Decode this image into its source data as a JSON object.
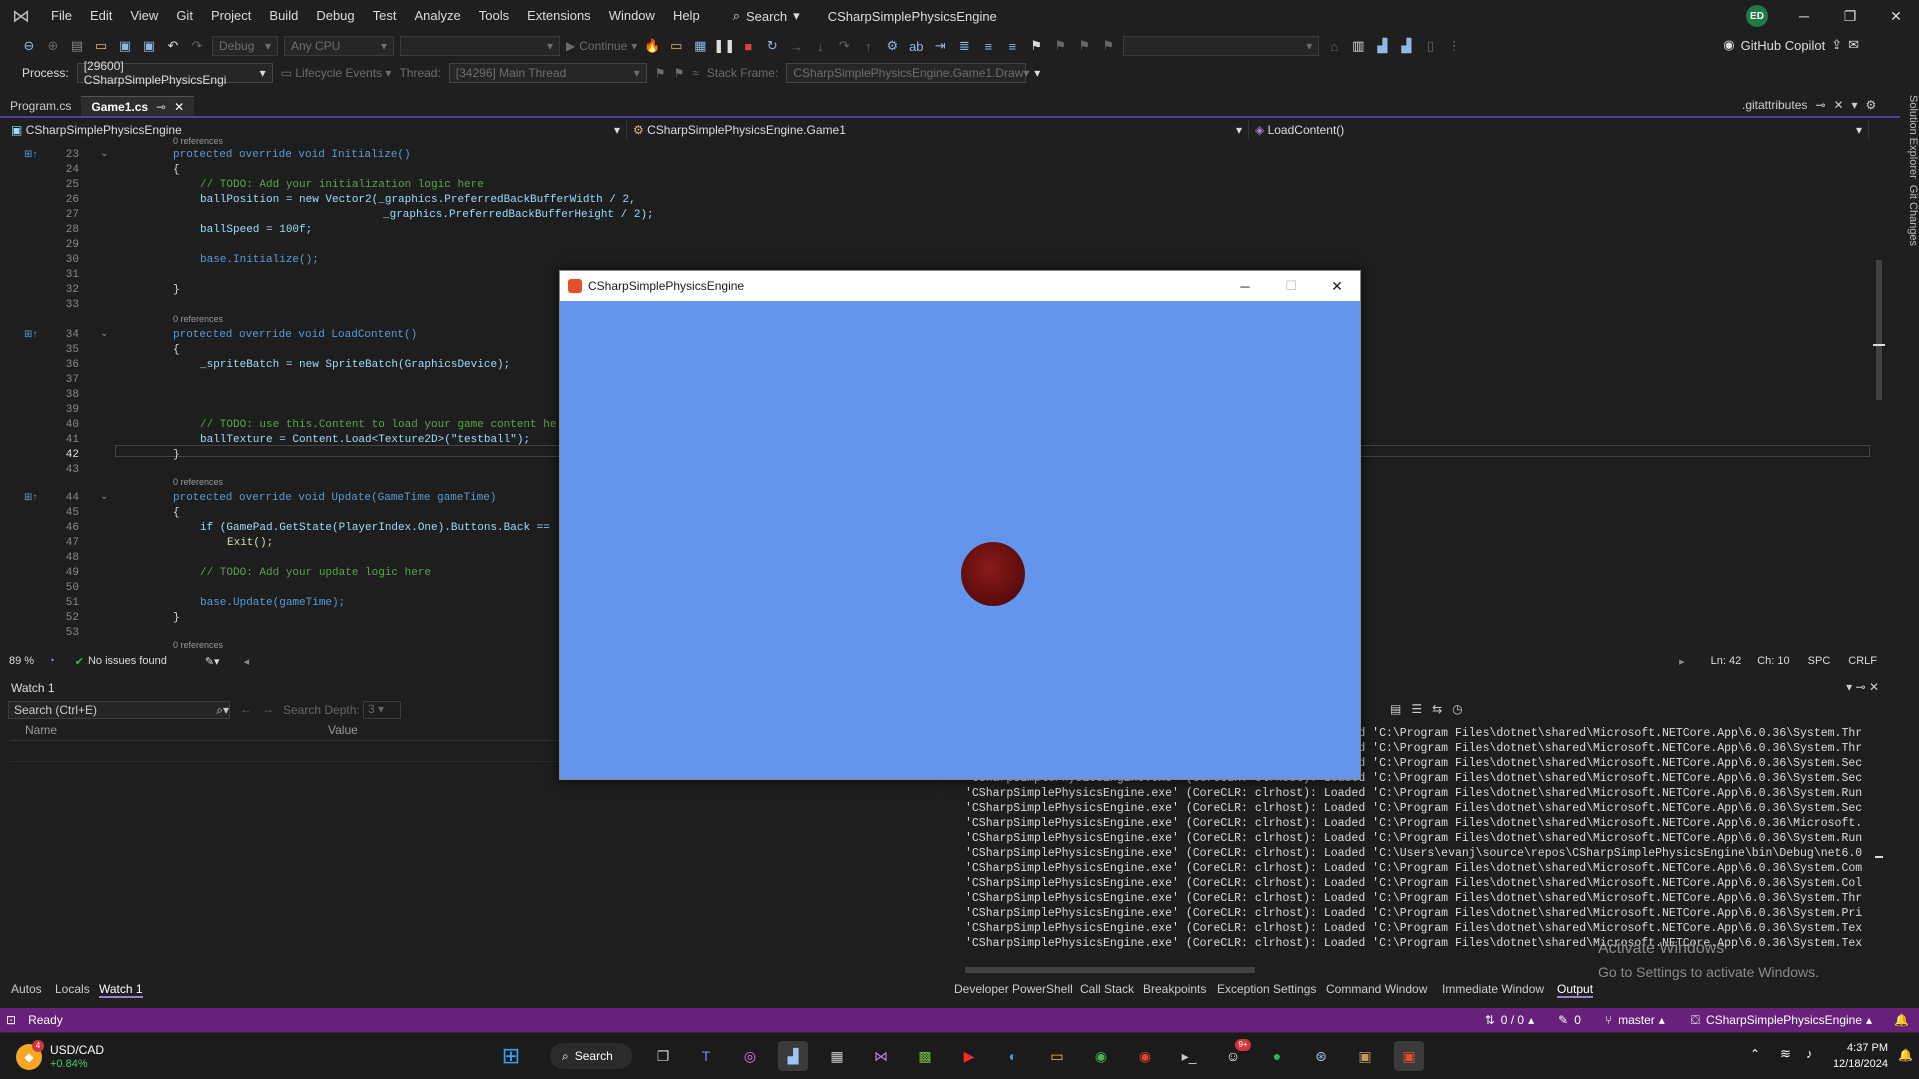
{
  "titlebar": {
    "menu": [
      "File",
      "Edit",
      "View",
      "Git",
      "Project",
      "Build",
      "Debug",
      "Test",
      "Analyze",
      "Tools",
      "Extensions",
      "Window",
      "Help"
    ],
    "search_label": "Search",
    "solution": "CSharpSimplePhysicsEngine",
    "avatar": "ED"
  },
  "toolbar": {
    "config": "Debug",
    "platform": "Any CPU",
    "continue": "Continue",
    "copilot": "GitHub Copilot"
  },
  "procbar": {
    "process_label": "Process:",
    "process_value": "[29600] CSharpSimplePhysicsEngi",
    "lifecycle": "Lifecycle Events",
    "thread_label": "Thread:",
    "thread_value": "[34296] Main Thread",
    "stackframe_label": "Stack Frame:",
    "stackframe_value": "CSharpSimplePhysicsEngine.Game1.Draw"
  },
  "tabs": [
    {
      "label": "Program.cs"
    },
    {
      "label": "Game1.cs"
    }
  ],
  "gitattributes": ".gitattributes",
  "navbar": {
    "project": "CSharpSimplePhysicsEngine",
    "class": "CSharpSimplePhysicsEngine.Game1",
    "member": "LoadContent()"
  },
  "editor": {
    "refs": "0 references",
    "lines": {
      "l23": "protected override void Initialize()",
      "l25": "// TODO: Add your initialization logic here",
      "l26": "ballPosition = new Vector2(_graphics.PreferredBackBufferWidth / 2,",
      "l27": "_graphics.PreferredBackBufferHeight / 2);",
      "l28": "ballSpeed = 100f;",
      "l30": "base.Initialize();",
      "l34": "protected override void LoadContent()",
      "l36": "_spriteBatch = new SpriteBatch(GraphicsDevice);",
      "l40": "// TODO: use this.Content to load your game content he",
      "l41": "ballTexture = Content.Load<Texture2D>(\"testball\");",
      "l44": "protected override void Update(GameTime gameTime)",
      "l46": "if (GamePad.GetState(PlayerIndex.One).Buttons.Back ==",
      "l47": "Exit();",
      "l49": "// TODO: Add your update logic here",
      "l51": "base.Update(gameTime);"
    }
  },
  "edstatus": {
    "zoom": "89 %",
    "issues": "No issues found",
    "ln": "Ln: 42",
    "ch": "Ch: 10",
    "spc": "SPC",
    "crlf": "CRLF"
  },
  "watch": {
    "title": "Watch 1",
    "search_placeholder": "Search (Ctrl+E)",
    "depth_label": "Search Depth:",
    "depth_value": "3",
    "col_name": "Name",
    "col_value": "Value"
  },
  "output": {
    "lines": [
      "'CSharpSimplePhysicsEngine.exe' (CoreCLR: clrhost): Loaded 'C:\\Program Files\\dotnet\\shared\\Microsoft.NETCore.App\\6.0.36\\System.Thr",
      "'CSharpSimplePhysicsEngine.exe' (CoreCLR: clrhost): Loaded 'C:\\Program Files\\dotnet\\shared\\Microsoft.NETCore.App\\6.0.36\\System.Thr",
      "'CSharpSimplePhysicsEngine.exe' (CoreCLR: clrhost): Loaded 'C:\\Program Files\\dotnet\\shared\\Microsoft.NETCore.App\\6.0.36\\System.Sec",
      "'CSharpSimplePhysicsEngine.exe' (CoreCLR: clrhost): Loaded 'C:\\Program Files\\dotnet\\shared\\Microsoft.NETCore.App\\6.0.36\\System.Sec",
      "'CSharpSimplePhysicsEngine.exe' (CoreCLR: clrhost): Loaded 'C:\\Program Files\\dotnet\\shared\\Microsoft.NETCore.App\\6.0.36\\System.Run",
      "'CSharpSimplePhysicsEngine.exe' (CoreCLR: clrhost): Loaded 'C:\\Program Files\\dotnet\\shared\\Microsoft.NETCore.App\\6.0.36\\System.Sec",
      "'CSharpSimplePhysicsEngine.exe' (CoreCLR: clrhost): Loaded 'C:\\Program Files\\dotnet\\shared\\Microsoft.NETCore.App\\6.0.36\\Microsoft.",
      "'CSharpSimplePhysicsEngine.exe' (CoreCLR: clrhost): Loaded 'C:\\Program Files\\dotnet\\shared\\Microsoft.NETCore.App\\6.0.36\\System.Run",
      "'CSharpSimplePhysicsEngine.exe' (CoreCLR: clrhost): Loaded 'C:\\Users\\evanj\\source\\repos\\CSharpSimplePhysicsEngine\\bin\\Debug\\net6.0",
      "'CSharpSimplePhysicsEngine.exe' (CoreCLR: clrhost): Loaded 'C:\\Program Files\\dotnet\\shared\\Microsoft.NETCore.App\\6.0.36\\System.Com",
      "'CSharpSimplePhysicsEngine.exe' (CoreCLR: clrhost): Loaded 'C:\\Program Files\\dotnet\\shared\\Microsoft.NETCore.App\\6.0.36\\System.Col",
      "'CSharpSimplePhysicsEngine.exe' (CoreCLR: clrhost): Loaded 'C:\\Program Files\\dotnet\\shared\\Microsoft.NETCore.App\\6.0.36\\System.Thr",
      "'CSharpSimplePhysicsEngine.exe' (CoreCLR: clrhost): Loaded 'C:\\Program Files\\dotnet\\shared\\Microsoft.NETCore.App\\6.0.36\\System.Pri",
      "'CSharpSimplePhysicsEngine.exe' (CoreCLR: clrhost): Loaded 'C:\\Program Files\\dotnet\\shared\\Microsoft.NETCore.App\\6.0.36\\System.Tex",
      "'CSharpSimplePhysicsEngine.exe' (CoreCLR: clrhost): Loaded 'C:\\Program Files\\dotnet\\shared\\Microsoft.NETCore.App\\6.0.36\\System.Tex"
    ],
    "activate1": "Activate Windows",
    "activate2": "Go to Settings to activate Windows."
  },
  "bottom_tabs_left": [
    "Autos",
    "Locals",
    "Watch 1"
  ],
  "bottom_tabs_right": [
    "Developer PowerShell",
    "Call Stack",
    "Breakpoints",
    "Exception Settings",
    "Command Window",
    "Immediate Window",
    "Output"
  ],
  "statusbar": {
    "ready": "Ready",
    "updown": "0 / 0",
    "pencil": "0",
    "branch": "master",
    "project": "CSharpSimplePhysicsEngine"
  },
  "taskbar": {
    "ticker": "USD/CAD",
    "change": "+0.84%",
    "badge": "4",
    "search": "Search",
    "notif": "9+",
    "time": "4:37 PM",
    "date": "12/18/2024"
  },
  "gamewin": {
    "title": "CSharpSimplePhysicsEngine"
  },
  "colors": {
    "accent": "#68217a",
    "game_bg": "#6495ed",
    "ball": "#6b1010"
  }
}
